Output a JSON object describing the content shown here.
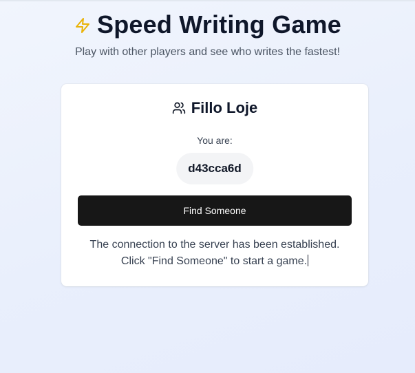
{
  "header": {
    "title": "Speed Writing Game",
    "subtitle": "Play with other players and see who writes the fastest!",
    "icon": "lightning-bolt-icon",
    "icon_color": "#eab308"
  },
  "card": {
    "room_icon": "users-icon",
    "room_name": "Fillo Loje",
    "you_are_label": "You are:",
    "player_id": "d43cca6d",
    "find_button_label": "Find Someone",
    "status_line_1": "The connection to the server has been established.",
    "status_line_2": "Click \"Find Someone\" to start a game."
  },
  "colors": {
    "background": "#eaf0fc",
    "button": "#171717",
    "title": "#0f172a",
    "badge_background": "#f3f4f6"
  }
}
